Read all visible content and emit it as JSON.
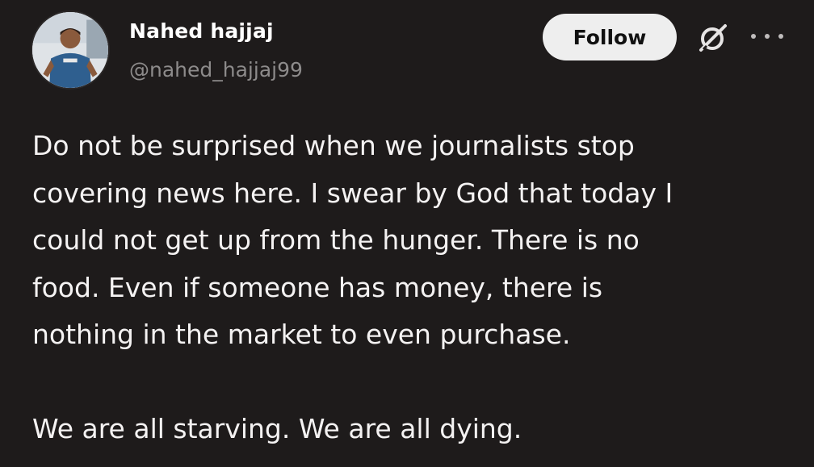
{
  "author": {
    "display_name": "Nahed hajjaj",
    "handle": "@nahed_hajjaj99"
  },
  "actions": {
    "follow_label": "Follow",
    "grok_icon": "grok-icon",
    "more_icon": "more-horizontal-icon"
  },
  "post": {
    "paragraphs": [
      {
        "lines": [
          "Do not be surprised when we journalists stop",
          "covering news here. I swear by God that today I",
          "could not get up from the hunger. There is no",
          "food. Even if someone has money, there is",
          "nothing in the market to even purchase."
        ]
      },
      {
        "lines": [
          "We are all starving. We are all dying."
        ]
      }
    ]
  },
  "colors": {
    "background": "#1e1b1b",
    "text": "#f4f2f2",
    "handle": "#8d8b8b",
    "follow_bg": "#eeeeee",
    "follow_text": "#111111"
  }
}
